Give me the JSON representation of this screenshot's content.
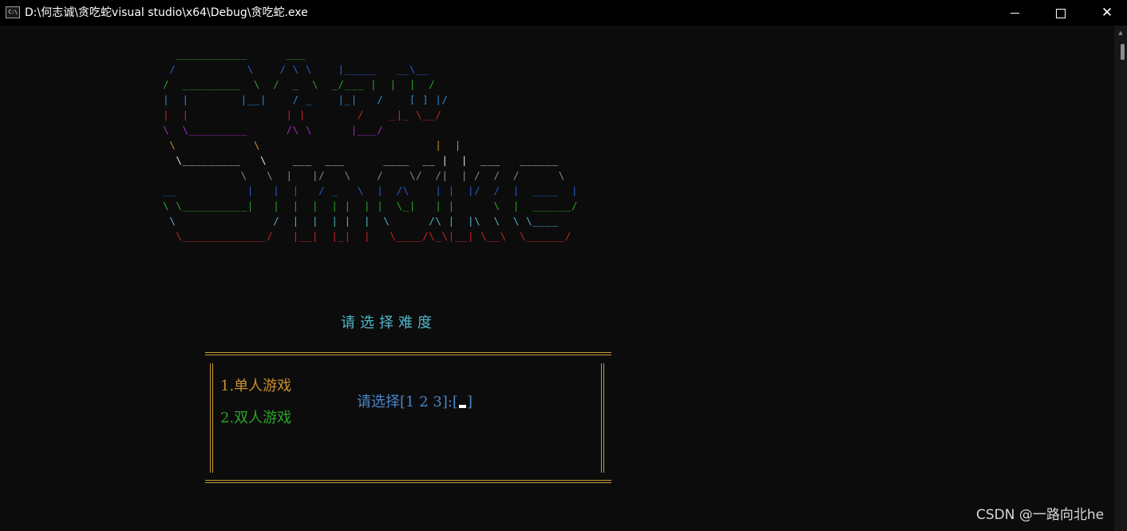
{
  "window": {
    "title": "D:\\何志诚\\贪吃蛇visual studio\\x64\\Debug\\贪吃蛇.exe",
    "app_icon_text": "C:\\",
    "minimize_icon": "minimize-icon",
    "maximize_icon": "maximize-icon",
    "close_icon": "close-icon"
  },
  "ascii_art": {
    "lines": [
      {
        "color": "#2aa52a",
        "text": "   ___________      ___\n"
      },
      {
        "color": "#2a5bd0",
        "text": "  /           \\    / \\ \\    |_____   __\\__\n"
      },
      {
        "color": "#2aa52a",
        "text": " /  _________  \\  /  _  \\  _/___ |  |  |  /\n"
      },
      {
        "color": "#2a8ad0",
        "text": " |  |        |__|    / _    |_|   /    [ ] |/\n"
      },
      {
        "color": "#c8262c",
        "text": " |  |               | |        /    _|_ \\__/\n"
      },
      {
        "color": "#a02ac0",
        "text": " \\  \\_________      /\\ \\      |___/\n"
      },
      {
        "color": "#c8902c",
        "text": "  \\            \\                           |  |\n"
      },
      {
        "color": "#e0e0e0",
        "text": "   \\_________   \\    ___  ___      ____  __ |  |  ___   ______\n"
      },
      {
        "color": "#8a8a8a",
        "text": "             \\   \\  |   |/   \\    /    \\/  /|  | /  /  /      \\\n"
      },
      {
        "color": "#2a5bd0",
        "text": " __           |   |  |   / _   \\  |  /\\    | |  |/  /  |  ____  |\n"
      },
      {
        "color": "#2aa52a",
        "text": " \\ \\__________|   |  |  |  | |  | |  \\_|   | |      \\  |  ______/\n"
      },
      {
        "color": "#4fb6c8",
        "text": "  \\               /  |  |  | |  |  \\      /\\ |  |\\  \\  \\ \\____\n"
      },
      {
        "color": "#c8262c",
        "text": "   \\_____________/   |__|  |_|  |   \\____/\\_\\|__| \\__\\  \\______/\n"
      }
    ]
  },
  "prompt_text": "请选择难度",
  "options": {
    "single": "1.单人游戏",
    "double": "2.双人游戏"
  },
  "select_prompt": {
    "before": "请选择[1 2 3]:[",
    "after": "]"
  },
  "watermark": "CSDN @一路向北he",
  "colors": {
    "background": "#0c0c0c",
    "border": "#c89a3a",
    "option_single": "#c8902c",
    "option_double": "#2aa52a",
    "prompt": "#4fb6c8",
    "select_prompt": "#4a86c8"
  }
}
